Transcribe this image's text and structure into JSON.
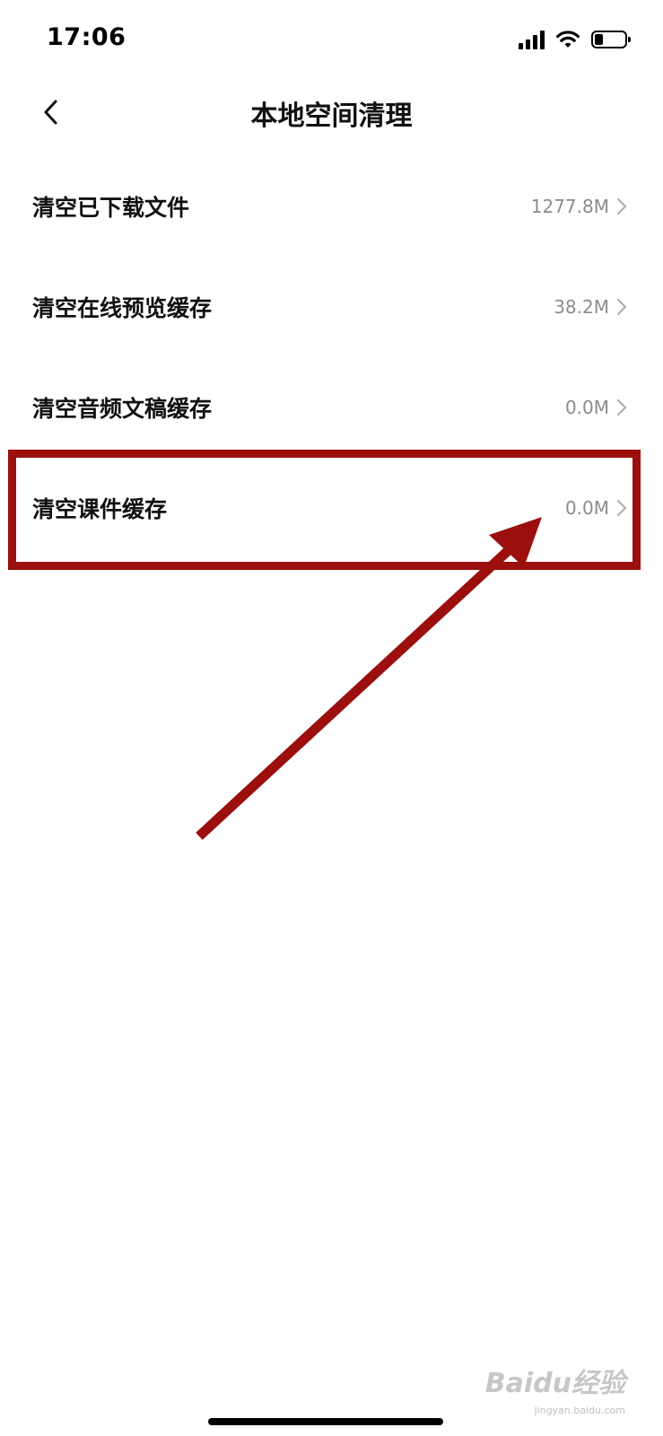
{
  "status_bar": {
    "time": "17:06",
    "battery_level": 0.3,
    "icons": [
      "signal-icon",
      "wifi-icon",
      "battery-icon"
    ]
  },
  "nav": {
    "title": "本地空间清理",
    "back_icon": "chevron-left-icon"
  },
  "items": [
    {
      "label": "清空已下载文件",
      "value": "1277.8M"
    },
    {
      "label": "清空在线预览缓存",
      "value": "38.2M"
    },
    {
      "label": "清空音频文稿缓存",
      "value": "0.0M"
    },
    {
      "label": "清空课件缓存",
      "value": "0.0M"
    }
  ],
  "annotation": {
    "color": "#9b0f0f",
    "highlighted_item": 3
  },
  "watermark": {
    "logo": "Baidu经验",
    "url": "jingyan.baidu.com"
  }
}
